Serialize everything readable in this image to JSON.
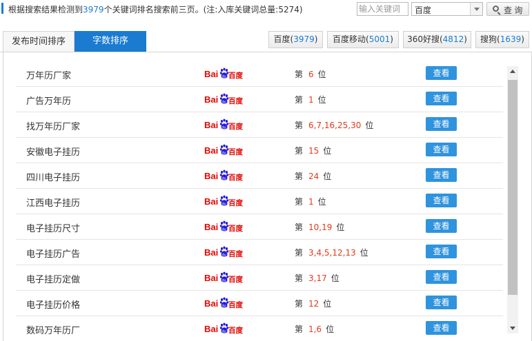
{
  "summary": {
    "prefix": "根据搜索结果检测到",
    "count": "3979",
    "suffix": "个关键词排名搜索前三页。(注:入库关键词总量:5274)"
  },
  "search": {
    "placeholder": "输入关键词",
    "engine_selected": "百度",
    "button_label": "查 询"
  },
  "sort_tabs": [
    {
      "label": "发布时间排序",
      "active": false
    },
    {
      "label": "字数排序",
      "active": true
    }
  ],
  "engine_tabs": [
    {
      "name": "百度",
      "count": "3979"
    },
    {
      "name": "百度移动",
      "count": "5001"
    },
    {
      "name": "360好搜",
      "count": "4812"
    },
    {
      "name": "搜狗",
      "count": "1639"
    }
  ],
  "rank_prefix": "第",
  "rank_suffix": "位",
  "view_label": "查看",
  "engine_logo": "baidu-logo",
  "rows": [
    {
      "keyword": "万年历厂家",
      "rank": "6"
    },
    {
      "keyword": "广告万年历",
      "rank": "1"
    },
    {
      "keyword": "找万年历厂家",
      "rank": "6,7,16,25,30"
    },
    {
      "keyword": "安徽电子挂历",
      "rank": "15"
    },
    {
      "keyword": "四川电子挂历",
      "rank": "24"
    },
    {
      "keyword": "江西电子挂历",
      "rank": "1"
    },
    {
      "keyword": "电子挂历尺寸",
      "rank": "10,19"
    },
    {
      "keyword": "电子挂历广告",
      "rank": "3,4,5,12,13"
    },
    {
      "keyword": "电子挂历定做",
      "rank": "3,17"
    },
    {
      "keyword": "电子挂历价格",
      "rank": "12"
    },
    {
      "keyword": "数码万年历厂",
      "rank": "1,6"
    }
  ],
  "colors": {
    "accent": "#1a7bd1",
    "rank": "#e03b1c",
    "button": "#2f93dd",
    "baidu_red": "#e10601",
    "baidu_blue": "#2319dc"
  }
}
